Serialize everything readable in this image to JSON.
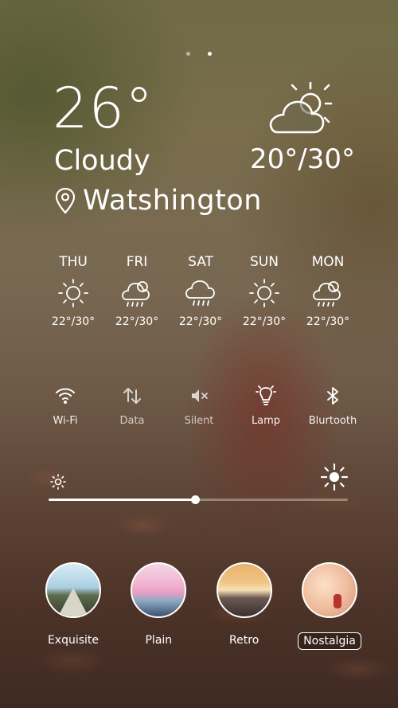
{
  "pager": {
    "pages": 2,
    "active_index": 1
  },
  "current": {
    "temperature": "26°",
    "condition": "Cloudy",
    "location": "Watshington",
    "range": "20°/30°",
    "icon": "partly-cloudy-icon"
  },
  "forecast": [
    {
      "day": "THU",
      "temp": "22°/30°",
      "icon": "sun-icon"
    },
    {
      "day": "FRI",
      "temp": "22°/30°",
      "icon": "cloud-rain-sun-icon"
    },
    {
      "day": "SAT",
      "temp": "22°/30°",
      "icon": "cloud-rain-icon"
    },
    {
      "day": "SUN",
      "temp": "22°/30°",
      "icon": "sun-icon"
    },
    {
      "day": "MON",
      "temp": "22°/30°",
      "icon": "cloud-rain-sun-icon"
    }
  ],
  "toggles": [
    {
      "label": "Wi-Fi",
      "icon": "wifi-icon"
    },
    {
      "label": "Data",
      "icon": "data-arrows-icon"
    },
    {
      "label": "Silent",
      "icon": "speaker-mute-icon"
    },
    {
      "label": "Lamp",
      "icon": "lamp-icon"
    },
    {
      "label": "Blurtooth",
      "icon": "bluetooth-icon"
    }
  ],
  "brightness": {
    "level": 0.49,
    "low_icon": "brightness-low-icon",
    "high_icon": "brightness-high-icon"
  },
  "themes": [
    {
      "label": "Exquisite",
      "selected": false
    },
    {
      "label": "Plain",
      "selected": false
    },
    {
      "label": "Retro",
      "selected": false
    },
    {
      "label": "Nostalgia",
      "selected": true
    }
  ]
}
